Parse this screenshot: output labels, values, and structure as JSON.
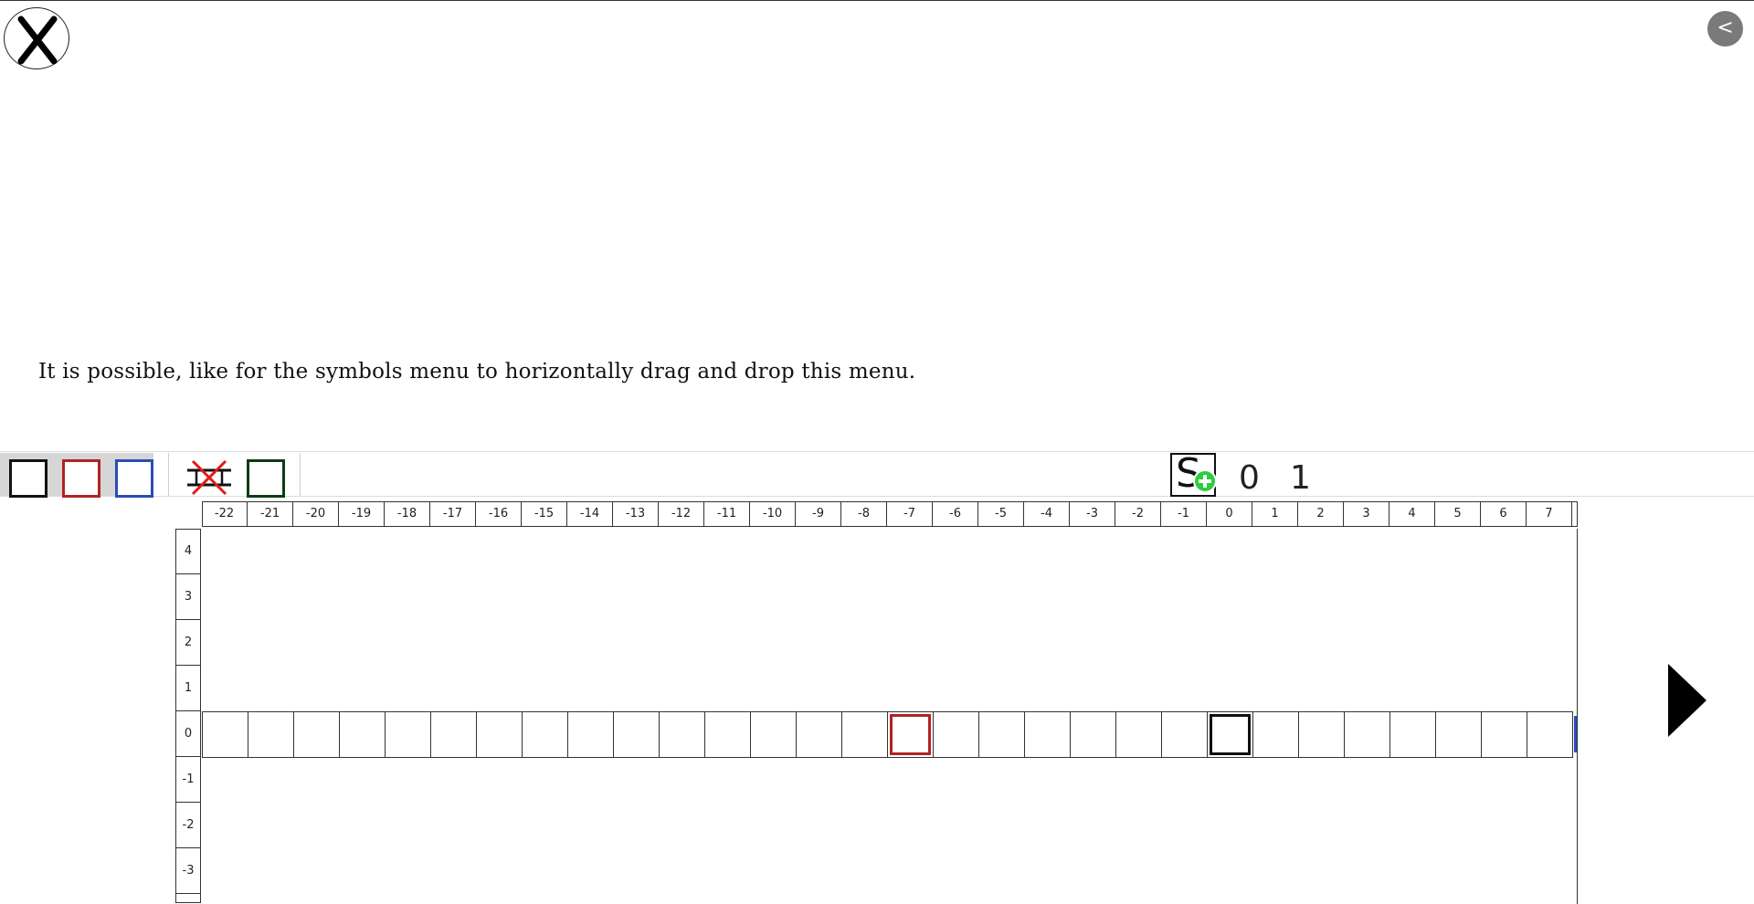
{
  "header": {
    "close_icon": "x-circle-icon",
    "back_label": "<"
  },
  "instruction": {
    "text": "It is possible, like for the symbols menu to horizontally drag and drop this menu."
  },
  "toolbar": {
    "left_symbols": [
      {
        "name": "square-black",
        "color": "#111111"
      },
      {
        "name": "square-red",
        "color": "#b22222"
      },
      {
        "name": "square-blue",
        "color": "#2a4db5"
      }
    ],
    "delete_icon": "delete-tape-icon",
    "green_square_color": "#0b3d12",
    "add_state_label": "S",
    "add_state_badge_color": "#2ecc40",
    "states": [
      "0",
      "1"
    ]
  },
  "grid": {
    "columns": [
      "-22",
      "-21",
      "-20",
      "-19",
      "-18",
      "-17",
      "-16",
      "-15",
      "-14",
      "-13",
      "-12",
      "-11",
      "-10",
      "-9",
      "-8",
      "-7",
      "-6",
      "-5",
      "-4",
      "-3",
      "-2",
      "-1",
      "0",
      "1",
      "2",
      "3",
      "4",
      "5",
      "6",
      "7"
    ],
    "rows": [
      "4",
      "3",
      "2",
      "1",
      "0",
      "-1",
      "-2",
      "-3"
    ],
    "tape_row": "0",
    "marked_cells": [
      {
        "column": "-7",
        "color": "#b22222"
      },
      {
        "column": "0",
        "color": "#111111"
      }
    ]
  },
  "navigation": {
    "next_icon": "play-triangle-icon"
  }
}
